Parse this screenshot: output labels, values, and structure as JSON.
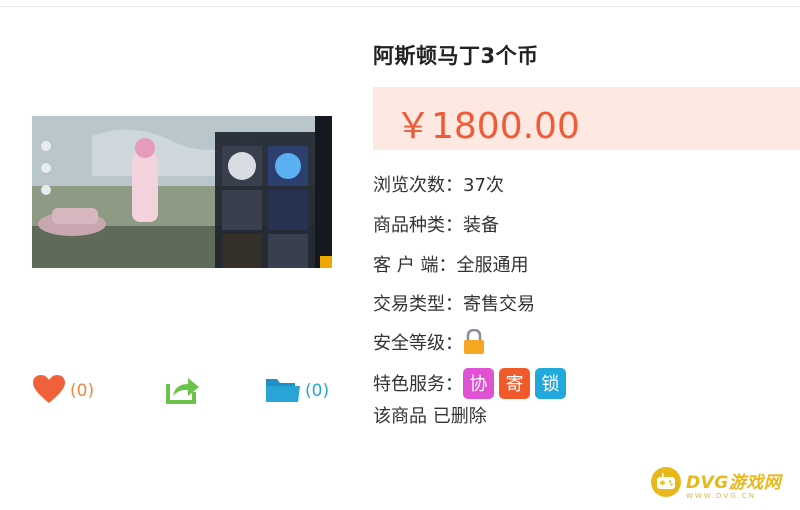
{
  "product": {
    "title": "阿斯顿马丁3个币",
    "price": "￥1800.00"
  },
  "info": [
    {
      "label": "浏览次数：",
      "value": "37次"
    },
    {
      "label": "商品种类：",
      "value": "装备"
    },
    {
      "label": "客 户 端：",
      "value": "全服通用"
    },
    {
      "label": "交易类型：",
      "value": "寄售交易"
    }
  ],
  "security": {
    "label": "安全等级：",
    "icon": "lock-icon"
  },
  "services": {
    "label": "特色服务：",
    "badges": [
      {
        "text": "协",
        "color": "#e051d4"
      },
      {
        "text": "寄",
        "color": "#f05a2b"
      },
      {
        "text": "锁",
        "color": "#21a8dd"
      }
    ]
  },
  "status": "该商品 已删除",
  "actions": {
    "like_count": "(0)",
    "collect_count": "(0)"
  },
  "watermark": {
    "brand": "DVG游戏网",
    "url": "WWW.DVG.CN"
  },
  "colors": {
    "price": "#ee5b36",
    "price_bg": "#fde8e2",
    "like": "#f0843f",
    "share": "#6cc24a",
    "collect": "#2aa3d6",
    "lock": "#f5a623"
  }
}
